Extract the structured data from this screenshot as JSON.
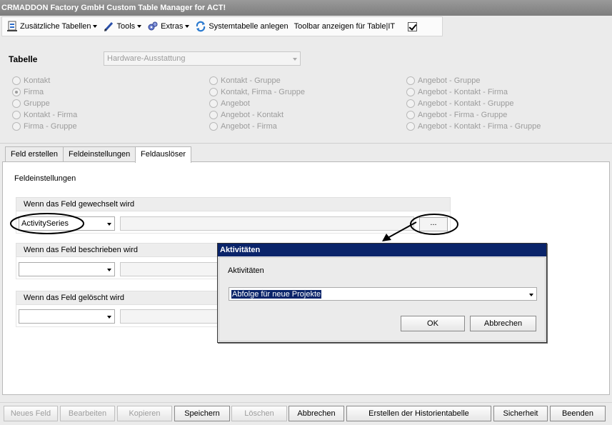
{
  "window": {
    "title": "CRMADDON Factory GmbH Custom Table Manager for ACT!"
  },
  "toolbar": {
    "zusaetzliche": "Zusätzliche Tabellen",
    "tools": "Tools",
    "extras": "Extras",
    "systemtabelle": "Systemtabelle anlegen",
    "toolbar_anzeigen": "Toolbar anzeigen für Table|IT",
    "toolbar_checked": true
  },
  "tabelle": {
    "label": "Tabelle",
    "value": "Hardware-Ausstattung"
  },
  "radios": {
    "col1": [
      {
        "label": "Kontakt",
        "checked": false
      },
      {
        "label": "Firma",
        "checked": true
      },
      {
        "label": "Gruppe",
        "checked": false
      },
      {
        "label": "Kontakt - Firma",
        "checked": false
      },
      {
        "label": "Firma - Gruppe",
        "checked": false
      }
    ],
    "col2": [
      {
        "label": "Kontakt - Gruppe",
        "checked": false
      },
      {
        "label": "Kontakt, Firma - Gruppe",
        "checked": false
      },
      {
        "label": "Angebot",
        "checked": false
      },
      {
        "label": "Angebot - Kontakt",
        "checked": false
      },
      {
        "label": "Angebot - Firma",
        "checked": false
      }
    ],
    "col3": [
      {
        "label": "Angebot - Gruppe",
        "checked": false
      },
      {
        "label": "Angebot - Kontakt - Firma",
        "checked": false
      },
      {
        "label": "Angebot - Kontakt - Gruppe",
        "checked": false
      },
      {
        "label": "Angebot - Firma - Gruppe",
        "checked": false
      },
      {
        "label": "Angebot - Kontakt - Firma - Gruppe",
        "checked": false
      }
    ]
  },
  "tabs": [
    {
      "label": "Feld erstellen",
      "active": false
    },
    {
      "label": "Feldeinstellungen",
      "active": false
    },
    {
      "label": "Feldauslöser",
      "active": true
    }
  ],
  "panel": {
    "title": "Feldeinstellungen",
    "groups": [
      {
        "header": "Wenn das Feld gewechselt wird",
        "combo_value": "ActivitySeries",
        "button": "..."
      },
      {
        "header": "Wenn das Feld beschrieben wird",
        "combo_value": ""
      },
      {
        "header": "Wenn das Feld gelöscht wird",
        "combo_value": ""
      }
    ]
  },
  "dialog": {
    "title": "Aktivitäten",
    "label": "Aktivitäten",
    "selected": "Abfolge für neue Projekte",
    "ok": "OK",
    "cancel": "Abbrechen"
  },
  "bottom_buttons": [
    {
      "label": "Neues Feld",
      "enabled": false
    },
    {
      "label": "Bearbeiten",
      "enabled": false
    },
    {
      "label": "Kopieren",
      "enabled": false
    },
    {
      "label": "Speichern",
      "enabled": true
    },
    {
      "label": "Löschen",
      "enabled": false
    },
    {
      "label": "Abbrechen",
      "enabled": true
    },
    {
      "label": "Erstellen der Historientabelle",
      "enabled": true
    },
    {
      "label": "Sicherheit",
      "enabled": true
    },
    {
      "label": "Beenden",
      "enabled": true
    }
  ],
  "colors": {
    "title_bar": "#8a8a8a",
    "dialog_title": "#0a246a",
    "selection": "#0a246a"
  }
}
